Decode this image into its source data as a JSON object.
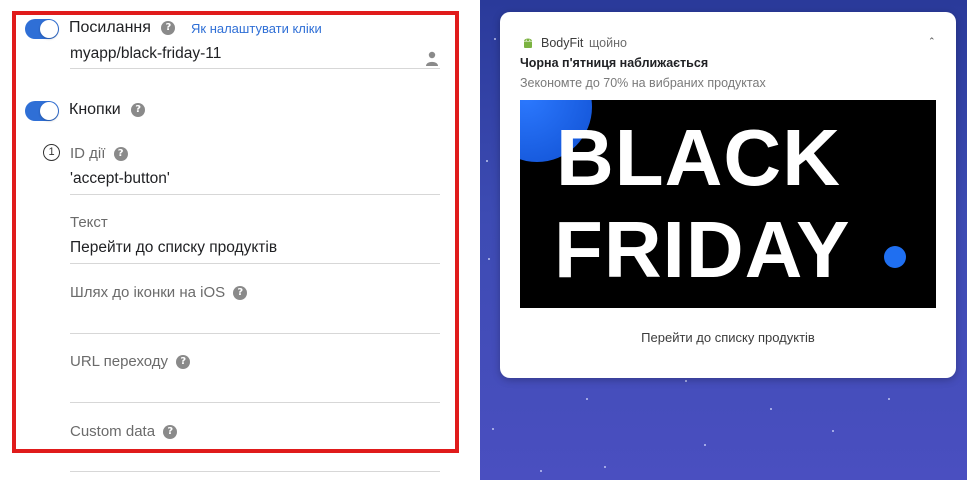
{
  "form": {
    "link_section": {
      "title": "Посилання",
      "help_link": "Як налаштувати кліки",
      "value": "myapp/black-friday-11"
    },
    "buttons_section": {
      "title": "Кнопки",
      "index": "1",
      "fields": [
        {
          "label": "ID дії",
          "value": "'accept-button'",
          "help": true
        },
        {
          "label": "Текст",
          "value": "Перейти до списку продуктів",
          "help": false
        },
        {
          "label": "Шлях до іконки на iOS",
          "value": "",
          "help": true
        },
        {
          "label": "URL переходу",
          "value": "",
          "help": true
        },
        {
          "label": "Custom data",
          "value": "",
          "help": true
        }
      ]
    },
    "accent_color": "#2f6fd6",
    "highlight_border_color": "#e01b1b"
  },
  "preview": {
    "app_name": "BodyFit",
    "time": "щойно",
    "title": "Чорна п'ятниця наближається",
    "body": "Зекономте до 70% на вибраних продуктах",
    "banner": {
      "line1": "BLACK",
      "line2": "FRIDAY"
    },
    "action_button": "Перейти до списку продуктів",
    "icons": [
      "android-icon",
      "chevron-up-icon"
    ]
  }
}
